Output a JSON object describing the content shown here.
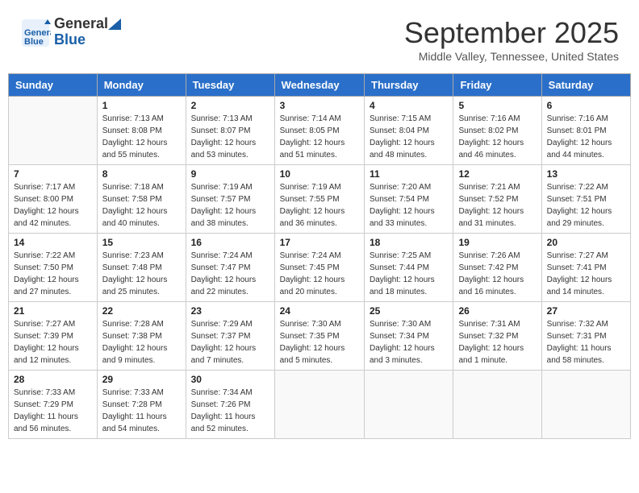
{
  "header": {
    "logo_line1": "General",
    "logo_line2": "Blue",
    "month": "September 2025",
    "location": "Middle Valley, Tennessee, United States"
  },
  "weekdays": [
    "Sunday",
    "Monday",
    "Tuesday",
    "Wednesday",
    "Thursday",
    "Friday",
    "Saturday"
  ],
  "weeks": [
    [
      {
        "day": "",
        "info": ""
      },
      {
        "day": "1",
        "info": "Sunrise: 7:13 AM\nSunset: 8:08 PM\nDaylight: 12 hours\nand 55 minutes."
      },
      {
        "day": "2",
        "info": "Sunrise: 7:13 AM\nSunset: 8:07 PM\nDaylight: 12 hours\nand 53 minutes."
      },
      {
        "day": "3",
        "info": "Sunrise: 7:14 AM\nSunset: 8:05 PM\nDaylight: 12 hours\nand 51 minutes."
      },
      {
        "day": "4",
        "info": "Sunrise: 7:15 AM\nSunset: 8:04 PM\nDaylight: 12 hours\nand 48 minutes."
      },
      {
        "day": "5",
        "info": "Sunrise: 7:16 AM\nSunset: 8:02 PM\nDaylight: 12 hours\nand 46 minutes."
      },
      {
        "day": "6",
        "info": "Sunrise: 7:16 AM\nSunset: 8:01 PM\nDaylight: 12 hours\nand 44 minutes."
      }
    ],
    [
      {
        "day": "7",
        "info": "Sunrise: 7:17 AM\nSunset: 8:00 PM\nDaylight: 12 hours\nand 42 minutes."
      },
      {
        "day": "8",
        "info": "Sunrise: 7:18 AM\nSunset: 7:58 PM\nDaylight: 12 hours\nand 40 minutes."
      },
      {
        "day": "9",
        "info": "Sunrise: 7:19 AM\nSunset: 7:57 PM\nDaylight: 12 hours\nand 38 minutes."
      },
      {
        "day": "10",
        "info": "Sunrise: 7:19 AM\nSunset: 7:55 PM\nDaylight: 12 hours\nand 36 minutes."
      },
      {
        "day": "11",
        "info": "Sunrise: 7:20 AM\nSunset: 7:54 PM\nDaylight: 12 hours\nand 33 minutes."
      },
      {
        "day": "12",
        "info": "Sunrise: 7:21 AM\nSunset: 7:52 PM\nDaylight: 12 hours\nand 31 minutes."
      },
      {
        "day": "13",
        "info": "Sunrise: 7:22 AM\nSunset: 7:51 PM\nDaylight: 12 hours\nand 29 minutes."
      }
    ],
    [
      {
        "day": "14",
        "info": "Sunrise: 7:22 AM\nSunset: 7:50 PM\nDaylight: 12 hours\nand 27 minutes."
      },
      {
        "day": "15",
        "info": "Sunrise: 7:23 AM\nSunset: 7:48 PM\nDaylight: 12 hours\nand 25 minutes."
      },
      {
        "day": "16",
        "info": "Sunrise: 7:24 AM\nSunset: 7:47 PM\nDaylight: 12 hours\nand 22 minutes."
      },
      {
        "day": "17",
        "info": "Sunrise: 7:24 AM\nSunset: 7:45 PM\nDaylight: 12 hours\nand 20 minutes."
      },
      {
        "day": "18",
        "info": "Sunrise: 7:25 AM\nSunset: 7:44 PM\nDaylight: 12 hours\nand 18 minutes."
      },
      {
        "day": "19",
        "info": "Sunrise: 7:26 AM\nSunset: 7:42 PM\nDaylight: 12 hours\nand 16 minutes."
      },
      {
        "day": "20",
        "info": "Sunrise: 7:27 AM\nSunset: 7:41 PM\nDaylight: 12 hours\nand 14 minutes."
      }
    ],
    [
      {
        "day": "21",
        "info": "Sunrise: 7:27 AM\nSunset: 7:39 PM\nDaylight: 12 hours\nand 12 minutes."
      },
      {
        "day": "22",
        "info": "Sunrise: 7:28 AM\nSunset: 7:38 PM\nDaylight: 12 hours\nand 9 minutes."
      },
      {
        "day": "23",
        "info": "Sunrise: 7:29 AM\nSunset: 7:37 PM\nDaylight: 12 hours\nand 7 minutes."
      },
      {
        "day": "24",
        "info": "Sunrise: 7:30 AM\nSunset: 7:35 PM\nDaylight: 12 hours\nand 5 minutes."
      },
      {
        "day": "25",
        "info": "Sunrise: 7:30 AM\nSunset: 7:34 PM\nDaylight: 12 hours\nand 3 minutes."
      },
      {
        "day": "26",
        "info": "Sunrise: 7:31 AM\nSunset: 7:32 PM\nDaylight: 12 hours\nand 1 minute."
      },
      {
        "day": "27",
        "info": "Sunrise: 7:32 AM\nSunset: 7:31 PM\nDaylight: 11 hours\nand 58 minutes."
      }
    ],
    [
      {
        "day": "28",
        "info": "Sunrise: 7:33 AM\nSunset: 7:29 PM\nDaylight: 11 hours\nand 56 minutes."
      },
      {
        "day": "29",
        "info": "Sunrise: 7:33 AM\nSunset: 7:28 PM\nDaylight: 11 hours\nand 54 minutes."
      },
      {
        "day": "30",
        "info": "Sunrise: 7:34 AM\nSunset: 7:26 PM\nDaylight: 11 hours\nand 52 minutes."
      },
      {
        "day": "",
        "info": ""
      },
      {
        "day": "",
        "info": ""
      },
      {
        "day": "",
        "info": ""
      },
      {
        "day": "",
        "info": ""
      }
    ]
  ]
}
